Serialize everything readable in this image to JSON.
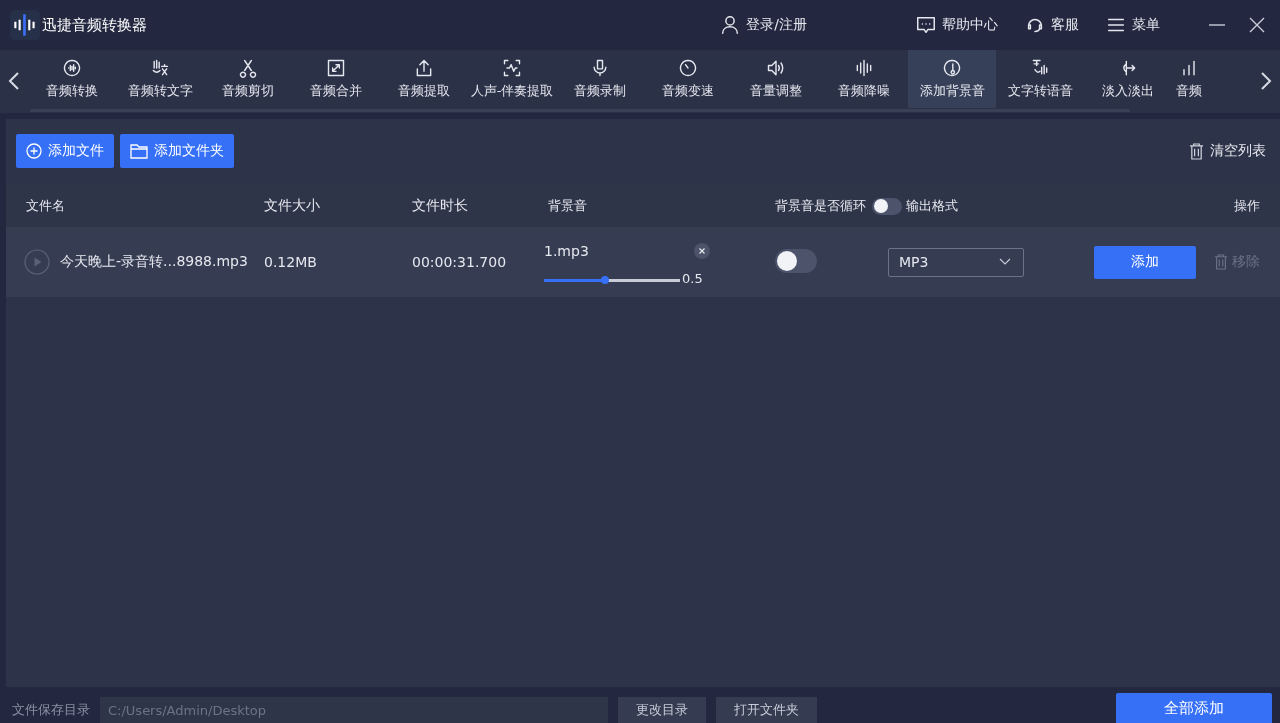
{
  "app": {
    "title": "迅捷音频转换器"
  },
  "header_actions": [
    {
      "kind": "user",
      "label": "登录/注册"
    },
    {
      "kind": "help",
      "label": "帮助中心"
    },
    {
      "kind": "service",
      "label": "客服"
    },
    {
      "kind": "menu",
      "label": "菜单"
    }
  ],
  "tools": [
    {
      "label": "音频转换",
      "selected": false
    },
    {
      "label": "音频转文字",
      "selected": false
    },
    {
      "label": "音频剪切",
      "selected": false
    },
    {
      "label": "音频合并",
      "selected": false
    },
    {
      "label": "音频提取",
      "selected": false
    },
    {
      "label": "人声-伴奏提取",
      "selected": false
    },
    {
      "label": "音频录制",
      "selected": false
    },
    {
      "label": "音频变速",
      "selected": false
    },
    {
      "label": "音量调整",
      "selected": false
    },
    {
      "label": "音频降噪",
      "selected": false
    },
    {
      "label": "添加背景音",
      "selected": true
    },
    {
      "label": "文字转语音",
      "selected": false
    },
    {
      "label": "淡入淡出",
      "selected": false
    },
    {
      "label": "音频",
      "selected": false
    }
  ],
  "toolbar": {
    "add_file": "添加文件",
    "add_folder": "添加文件夹",
    "clear": "清空列表"
  },
  "table": {
    "columns": [
      "文件名",
      "文件大小",
      "文件时长",
      "背景音",
      "背景音是否循环",
      "输出格式",
      "操作"
    ],
    "loop_all_on": false,
    "rows": [
      {
        "name": "今天晚上-录音转...8988.mp3",
        "size": "0.12MB",
        "duration": "00:00:31.700",
        "bg_file": "1.mp3",
        "volume": {
          "level": 0.45,
          "reading": "0.5"
        },
        "loop": false,
        "format": "MP3",
        "add": "添加",
        "remove": "移除"
      }
    ]
  },
  "footer": {
    "label": "文件保存目录",
    "path": "C:/Users/Admin/Desktop",
    "change": "更改目录",
    "open": "打开文件夹",
    "convert_all": "全部添加"
  }
}
